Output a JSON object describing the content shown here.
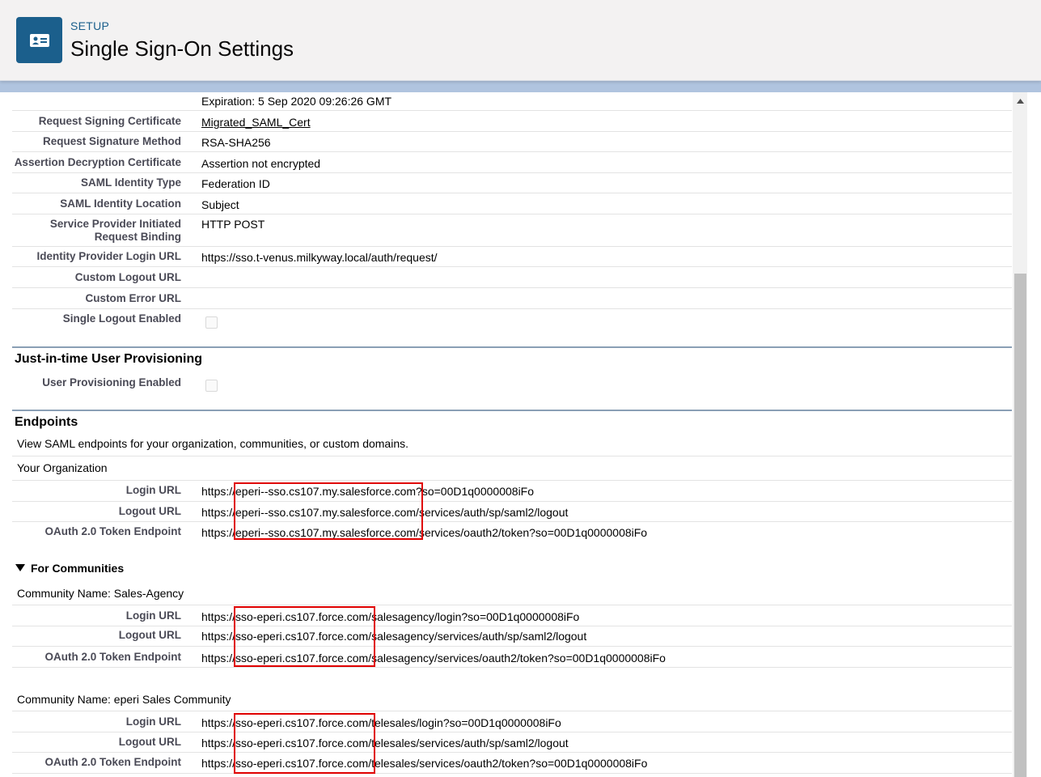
{
  "header": {
    "setup_label": "SETUP",
    "title": "Single Sign-On Settings",
    "icon": "id-card-icon"
  },
  "saml_settings": {
    "expiration": "Expiration: 5 Sep 2020 09:26:26 GMT",
    "rows": [
      {
        "label": "Request Signing Certificate",
        "value": "Migrated_SAML_Cert"
      },
      {
        "label": "Request Signature Method",
        "value": "RSA-SHA256"
      },
      {
        "label": "Assertion Decryption Certificate",
        "value": "Assertion not encrypted"
      },
      {
        "label": "SAML Identity Type",
        "value": "Federation ID"
      },
      {
        "label": "SAML Identity Location",
        "value": "Subject"
      },
      {
        "label_line1": "Service Provider Initiated",
        "label_line2": "Request Binding",
        "value": "HTTP POST"
      },
      {
        "label": "Identity Provider Login URL",
        "value": "https://sso.t-venus.milkyway.local/auth/request/"
      },
      {
        "label": "Custom Logout URL",
        "value": ""
      },
      {
        "label": "Custom Error URL",
        "value": ""
      },
      {
        "label": "Single Logout Enabled",
        "checked": false
      }
    ]
  },
  "jit": {
    "title": "Just-in-time User Provisioning",
    "label": "User Provisioning Enabled",
    "checked": false
  },
  "endpoints": {
    "title": "Endpoints",
    "description": "View SAML endpoints for your organization, communities, or custom domains.",
    "your_org": "Your Organization",
    "org_rows": [
      {
        "label": "Login URL",
        "value": "https://eperi--sso.cs107.my.salesforce.com?so=00D1q0000008iFo"
      },
      {
        "label": "Logout URL",
        "value": "https://eperi--sso.cs107.my.salesforce.com/services/auth/sp/saml2/logout"
      },
      {
        "label": "OAuth 2.0 Token Endpoint",
        "value": "https://eperi--sso.cs107.my.salesforce.com/services/oauth2/token?so=00D1q0000008iFo"
      }
    ],
    "communities_title": "For Communities",
    "communities": [
      {
        "name": "Community Name: Sales-Agency",
        "rows": [
          {
            "label": "Login URL",
            "value": "https://sso-eperi.cs107.force.com/salesagency/login?so=00D1q0000008iFo"
          },
          {
            "label": "Logout URL",
            "value": "https://sso-eperi.cs107.force.com/salesagency/services/auth/sp/saml2/logout"
          },
          {
            "label": "OAuth 2.0 Token Endpoint",
            "value": "https://sso-eperi.cs107.force.com/salesagency/services/oauth2/token?so=00D1q0000008iFo"
          }
        ]
      },
      {
        "name": "Community Name: eperi Sales Community",
        "rows": [
          {
            "label": "Login URL",
            "value": "https://sso-eperi.cs107.force.com/telesales/login?so=00D1q0000008iFo"
          },
          {
            "label": "Logout URL",
            "value": "https://sso-eperi.cs107.force.com/telesales/services/auth/sp/saml2/logout"
          },
          {
            "label": "OAuth 2.0 Token Endpoint",
            "value": "https://sso-eperi.cs107.force.com/telesales/services/oauth2/token?so=00D1q0000008iFo"
          }
        ]
      }
    ]
  },
  "colors": {
    "brand": "#1b5f8c",
    "highlight": "#e00000"
  }
}
